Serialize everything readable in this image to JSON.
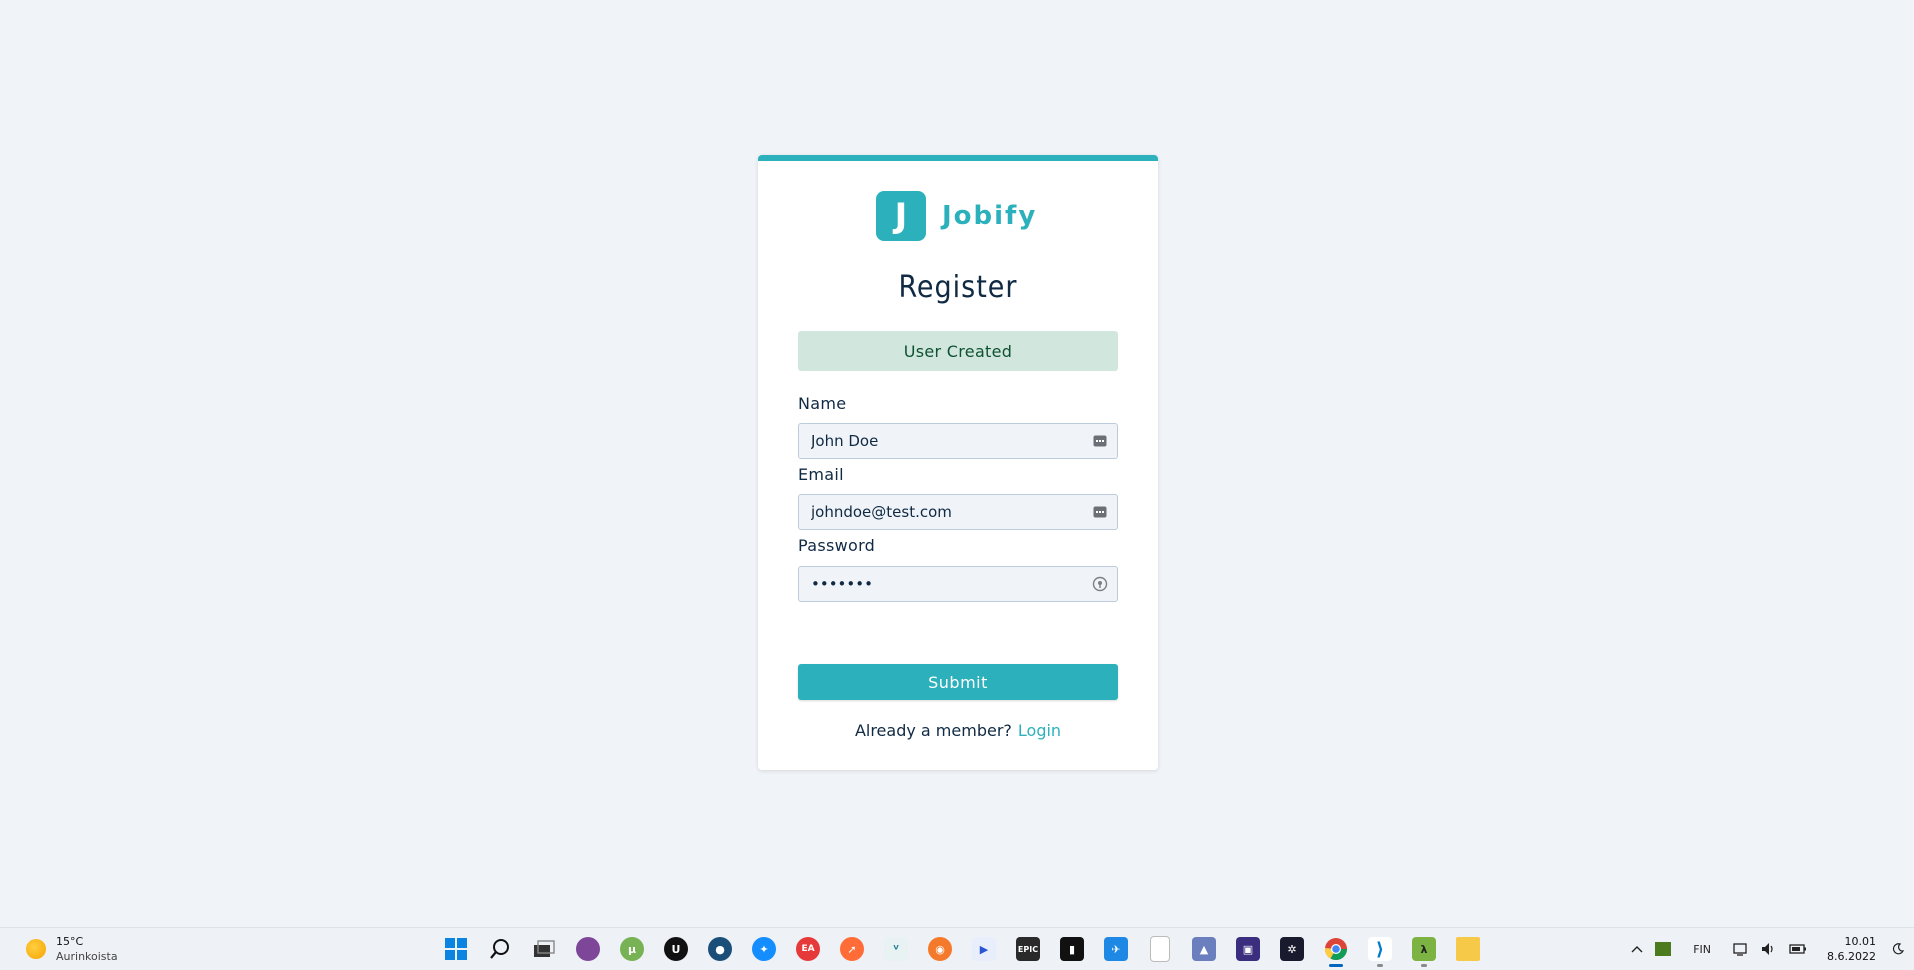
{
  "brand": {
    "logo_letter": "J",
    "name": "Jobify",
    "color": "#2cb1bc"
  },
  "form": {
    "title": "Register",
    "alert": {
      "text": "User Created",
      "bg": "#d1e7dd",
      "color": "#0f5132"
    },
    "fields": [
      {
        "label": "Name",
        "type": "text",
        "value": "John Doe",
        "icon": "autofill-card-icon"
      },
      {
        "label": "Email",
        "type": "email",
        "value": "johndoe@test.com",
        "icon": "autofill-card-icon"
      },
      {
        "label": "Password",
        "type": "password",
        "value": "secret1",
        "icon": "password-key-icon"
      }
    ],
    "submit_label": "Submit",
    "member_text": "Already a member?",
    "login_link": "Login"
  },
  "taskbar": {
    "weather": {
      "temp": "15°C",
      "desc": "Aurinkoista",
      "icon": "sun-icon"
    },
    "apps": [
      {
        "name": "windows-start-icon"
      },
      {
        "name": "search-icon"
      },
      {
        "name": "task-view-icon"
      },
      {
        "name": "tor-browser-icon"
      },
      {
        "name": "utorrent-icon"
      },
      {
        "name": "unreal-engine-icon"
      },
      {
        "name": "steam-icon"
      },
      {
        "name": "battle-net-icon"
      },
      {
        "name": "ea-app-icon"
      },
      {
        "name": "postman-icon"
      },
      {
        "name": "vortex-icon"
      },
      {
        "name": "blender-icon"
      },
      {
        "name": "media-player-icon"
      },
      {
        "name": "epic-games-icon",
        "label": "EPIC"
      },
      {
        "name": "audio-app-icon"
      },
      {
        "name": "launcher-app-icon"
      },
      {
        "name": "blank-file-icon"
      },
      {
        "name": "photos-app-icon"
      },
      {
        "name": "virtual-machine-icon"
      },
      {
        "name": "fan-control-icon"
      },
      {
        "name": "chrome-icon",
        "state": "active"
      },
      {
        "name": "vscode-icon",
        "state": "running"
      },
      {
        "name": "half-life-icon",
        "state": "running"
      },
      {
        "name": "file-explorer-icon"
      }
    ],
    "tray": {
      "language": "FIN",
      "time": "10.01",
      "date": "8.6.2022"
    }
  }
}
